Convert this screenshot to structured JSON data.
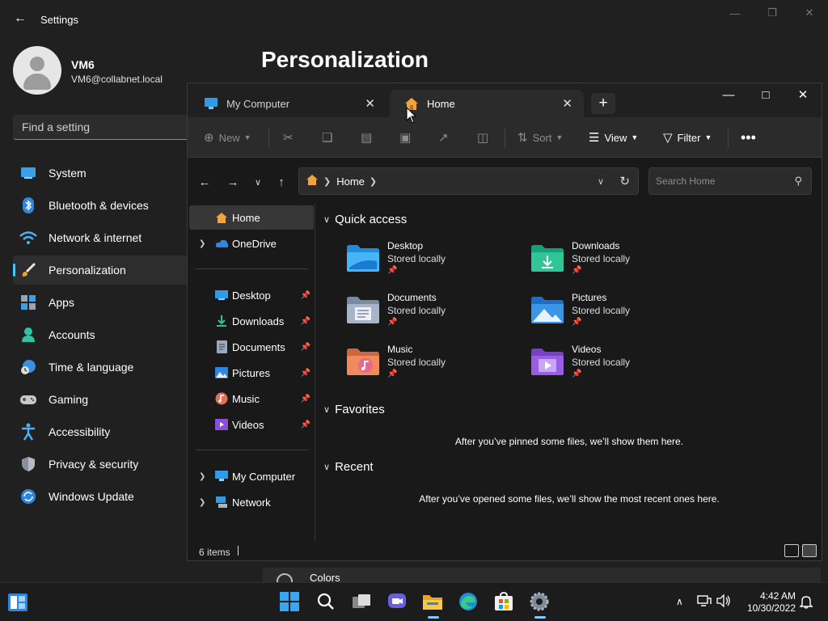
{
  "settings": {
    "title": "Settings",
    "user": {
      "name": "VM6",
      "email": "VM6@collabnet.local"
    },
    "search_placeholder": "Find a setting",
    "page_title": "Personalization",
    "nav": [
      {
        "label": "System",
        "icon": "monitor-icon"
      },
      {
        "label": "Bluetooth & devices",
        "icon": "bluetooth-icon"
      },
      {
        "label": "Network & internet",
        "icon": "wifi-icon"
      },
      {
        "label": "Personalization",
        "icon": "brush-icon",
        "active": true
      },
      {
        "label": "Apps",
        "icon": "apps-icon"
      },
      {
        "label": "Accounts",
        "icon": "person-icon"
      },
      {
        "label": "Time & language",
        "icon": "clock-globe-icon"
      },
      {
        "label": "Gaming",
        "icon": "gamepad-icon"
      },
      {
        "label": "Accessibility",
        "icon": "accessibility-icon"
      },
      {
        "label": "Privacy & security",
        "icon": "shield-icon"
      },
      {
        "label": "Windows Update",
        "icon": "update-icon"
      }
    ],
    "colors_label": "Colors"
  },
  "explorer": {
    "tabs": [
      {
        "label": "My Computer",
        "icon": "computer-icon",
        "active": false
      },
      {
        "label": "Home",
        "icon": "home-icon",
        "active": true
      }
    ],
    "toolbar": {
      "new_label": "New",
      "sort_label": "Sort",
      "view_label": "View",
      "filter_label": "Filter"
    },
    "address": {
      "segment": "Home"
    },
    "search_placeholder": "Search Home",
    "sidebar": {
      "home": "Home",
      "onedrive": "OneDrive",
      "pinned": [
        "Desktop",
        "Downloads",
        "Documents",
        "Pictures",
        "Music",
        "Videos"
      ],
      "my_computer": "My Computer",
      "network": "Network"
    },
    "quick_access": {
      "title": "Quick access",
      "items": [
        {
          "name": "Desktop",
          "status": "Stored locally",
          "icon": "desktop-folder-icon"
        },
        {
          "name": "Downloads",
          "status": "Stored locally",
          "icon": "downloads-folder-icon"
        },
        {
          "name": "Documents",
          "status": "Stored locally",
          "icon": "documents-folder-icon"
        },
        {
          "name": "Pictures",
          "status": "Stored locally",
          "icon": "pictures-folder-icon"
        },
        {
          "name": "Music",
          "status": "Stored locally",
          "icon": "music-folder-icon"
        },
        {
          "name": "Videos",
          "status": "Stored locally",
          "icon": "videos-folder-icon"
        }
      ]
    },
    "favorites": {
      "title": "Favorites",
      "empty": "After you’ve pinned some files, we’ll show them here."
    },
    "recent": {
      "title": "Recent",
      "empty": "After you’ve opened some files, we’ll show the most recent ones here."
    },
    "status": {
      "count": "6 items"
    }
  },
  "taskbar": {
    "clock": {
      "time": "4:42 AM",
      "date": "10/30/2022"
    }
  }
}
